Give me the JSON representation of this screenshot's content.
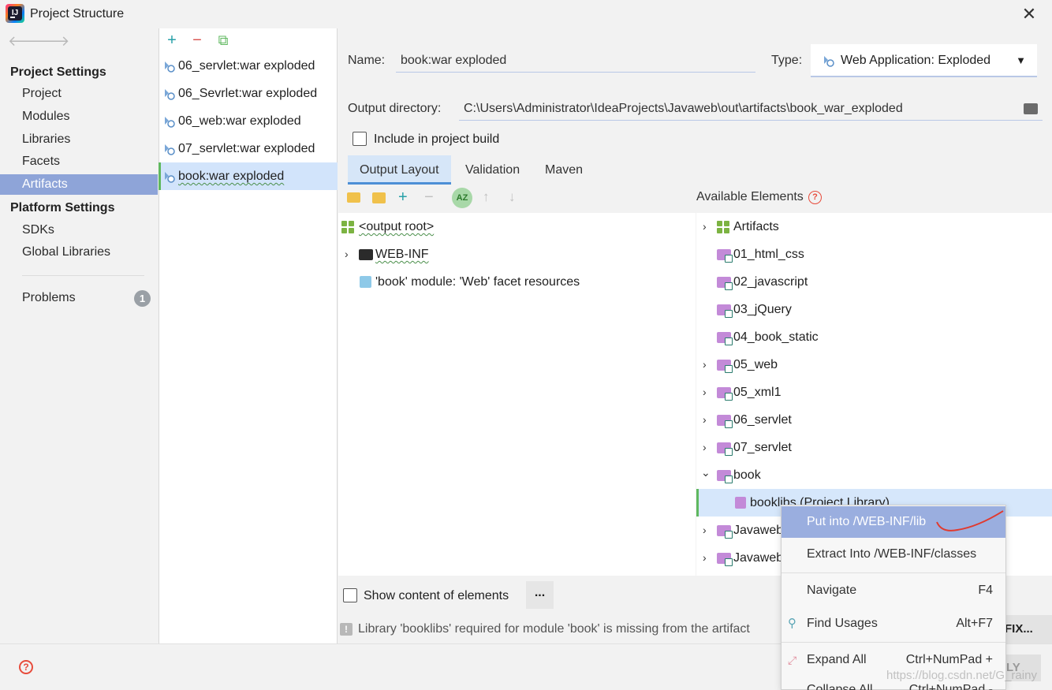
{
  "window": {
    "title": "Project Structure",
    "close": "✕"
  },
  "nav": {
    "back": "🡐",
    "forward": "🡒",
    "project_settings": "Project Settings",
    "items": [
      "Project",
      "Modules",
      "Libraries",
      "Facets",
      "Artifacts"
    ],
    "platform_settings": "Platform Settings",
    "platform_items": [
      "SDKs",
      "Global Libraries"
    ],
    "problems": "Problems",
    "problems_count": "1",
    "selected": "Artifacts"
  },
  "list_toolbar": {
    "add": "+",
    "remove": "−",
    "copy": "⧉"
  },
  "artifacts": [
    "06_servlet:war exploded",
    "06_Sevrlet:war exploded",
    "06_web:war exploded",
    "07_servlet:war exploded",
    "book:war exploded"
  ],
  "form": {
    "name_label": "Name:",
    "name_value": "book:war exploded",
    "type_label": "Type:",
    "type_value": "Web Application: Exploded",
    "output_label": "Output directory:",
    "output_value": "C:\\Users\\Administrator\\IdeaProjects\\Javaweb\\out\\artifacts\\book_war_exploded",
    "include_build_label": "Include in project build",
    "include_build_checked": false
  },
  "tabs": [
    "Output Layout",
    "Validation",
    "Maven"
  ],
  "active_tab": "Output Layout",
  "layout_tree": [
    {
      "label": "<output root>",
      "icon": "artifact-root-icon"
    },
    {
      "label": "WEB-INF",
      "icon": "folder-icon",
      "expandable": true
    },
    {
      "label": "'book' module: 'Web' facet resources",
      "icon": "web-facet-icon"
    }
  ],
  "available": {
    "title": "Available Elements",
    "items": [
      {
        "label": "Artifacts",
        "chevron": "›",
        "icon": "artifacts-icon"
      },
      {
        "label": "01_html_css",
        "chevron": "",
        "icon": "module-folder-icon"
      },
      {
        "label": "02_javascript",
        "chevron": "",
        "icon": "module-folder-icon"
      },
      {
        "label": "03_jQuery",
        "chevron": "",
        "icon": "module-folder-icon"
      },
      {
        "label": "04_book_static",
        "chevron": "",
        "icon": "module-folder-icon"
      },
      {
        "label": "05_web",
        "chevron": "›",
        "icon": "module-folder-icon"
      },
      {
        "label": "05_xml1",
        "chevron": "›",
        "icon": "module-folder-icon"
      },
      {
        "label": "06_servlet",
        "chevron": "›",
        "icon": "module-folder-icon"
      },
      {
        "label": "07_servlet",
        "chevron": "›",
        "icon": "module-folder-icon"
      },
      {
        "label": "book",
        "chevron": "⌄",
        "icon": "module-folder-icon"
      },
      {
        "label": "booklibs (Project Library)",
        "chevron": "",
        "icon": "library-icon"
      },
      {
        "label": "Javaweb",
        "chevron": "›",
        "icon": "module-folder-icon"
      },
      {
        "label": "Javaweb",
        "chevron": "›",
        "icon": "module-folder-icon"
      }
    ]
  },
  "context_menu": [
    {
      "label": "Put into /WEB-INF/lib",
      "shortcut": "",
      "selected": true
    },
    {
      "label": "Extract Into /WEB-INF/classes",
      "shortcut": ""
    },
    {
      "label": "Navigate",
      "shortcut": "F4"
    },
    {
      "label": "Find Usages",
      "shortcut": "Alt+F7"
    },
    {
      "label": "Expand All",
      "shortcut": "Ctrl+NumPad +"
    },
    {
      "label": "Collapse All",
      "shortcut": "Ctrl+NumPad -"
    }
  ],
  "show_content_label": "Show content of elements",
  "more_button": "...",
  "warning_text": "Library 'booklibs' required for module 'book' is missing from the artifact",
  "fix_button": "FIX...",
  "apply_button": "LY",
  "watermark": "https://blog.csdn.net/G_rainy",
  "colors": {
    "selection": "#8ea4d8",
    "menu_selected": "#9aaedf",
    "accent": "#4d8fd6",
    "green": "#5fb85f"
  }
}
